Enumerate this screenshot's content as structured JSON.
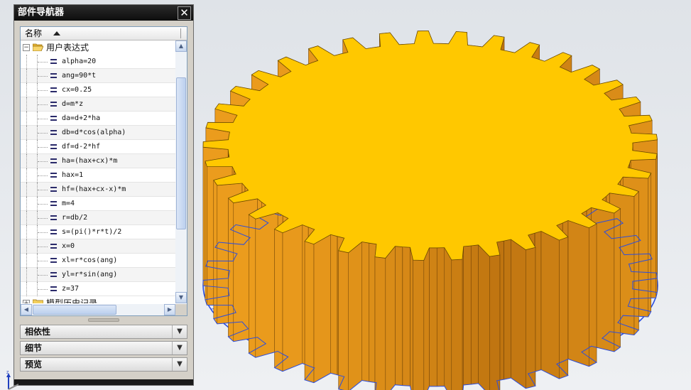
{
  "navigator": {
    "title": "部件导航器",
    "column_header": "名称",
    "group_label": "用户表达式",
    "next_group_label": "模型历史记录",
    "expressions": [
      "alpha=20",
      "ang=90*t",
      "cx=0.25",
      "d=m*z",
      "da=d+2*ha",
      "db=d*cos(alpha)",
      "df=d-2*hf",
      "ha=(hax+cx)*m",
      "hax=1",
      "hf=(hax+cx-x)*m",
      "m=4",
      "r=db/2",
      "s=(pi()*r*t)/2",
      "x=0",
      "xl=r*cos(ang)",
      "yl=r*sin(ang)",
      "z=37"
    ],
    "sections": [
      "相依性",
      "细节",
      "预览"
    ],
    "close_symbol": "✕"
  },
  "viewport": {
    "model": "spur gear",
    "tooth_count": 37,
    "top_face_color": "#ffc800",
    "side_color": "#c98a12",
    "edge_color": "#2a4de0"
  },
  "triad": {
    "z_label": "Z"
  }
}
